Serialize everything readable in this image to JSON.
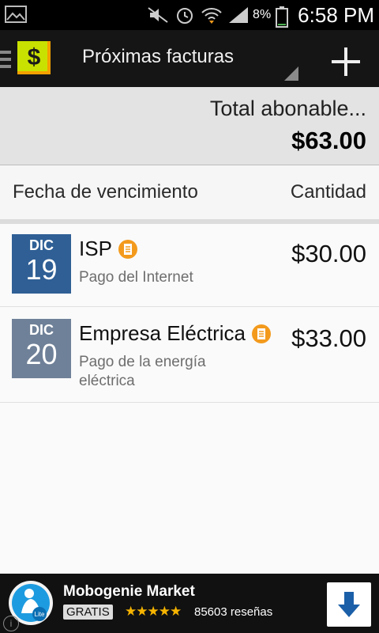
{
  "status_bar": {
    "battery_percent": "8%",
    "time": "6:58 PM"
  },
  "action_bar": {
    "title": "Próximas facturas",
    "logo_symbol": "$"
  },
  "total": {
    "label": "Total abonable...",
    "amount": "$63.00"
  },
  "columns": {
    "left": "Fecha de vencimiento",
    "right": "Cantidad"
  },
  "bills": [
    {
      "month": "DIC",
      "day": "19",
      "title": "ISP",
      "description": "Pago del Internet",
      "amount": "$30.00",
      "date_color": "#2f5f95"
    },
    {
      "month": "DIC",
      "day": "20",
      "title": "Empresa Eléctrica",
      "description": "Pago de la energía eléctrica",
      "amount": "$33.00",
      "date_color": "#6f8198"
    }
  ],
  "ad": {
    "name": "Mobogenie Market",
    "badge": "GRATIS",
    "stars": "★★★★★",
    "reviews": "85603 reseñas"
  },
  "colors": {
    "accent_orange": "#f39a1d",
    "action_bar_bg": "#151515"
  }
}
